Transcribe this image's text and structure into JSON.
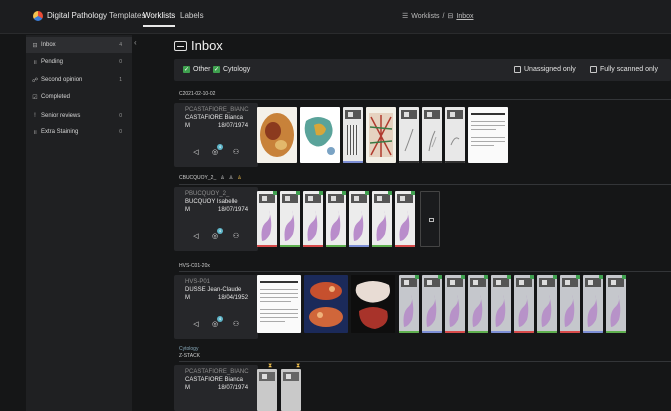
{
  "topbar": {
    "brand": "Digital Pathology",
    "nav": [
      "Templates",
      "Worklists",
      "Labels"
    ],
    "active_nav": "Worklists",
    "breadcrumb": {
      "root": "Worklists",
      "sep": "/",
      "current": "Inbox"
    }
  },
  "sidebar": {
    "items": [
      {
        "label": "Inbox",
        "count": "4",
        "icon": "tray-icon"
      },
      {
        "label": "Pending",
        "count": "0",
        "icon": "pause-icon"
      },
      {
        "label": "Second opinion",
        "count": "1",
        "icon": "people-icon"
      },
      {
        "label": "Completed",
        "count": "",
        "icon": "check-square-icon"
      },
      {
        "label": "Senior reviews",
        "count": "0",
        "icon": "exclamation-icon"
      },
      {
        "label": "Extra Staining",
        "count": "0",
        "icon": "pause-icon"
      }
    ]
  },
  "main": {
    "title": "Inbox",
    "filters": {
      "other": "Other",
      "cytology": "Cytology",
      "unassigned": "Unassigned only",
      "fully_scanned": "Fully scanned only"
    },
    "cases": [
      {
        "group_label": "C2021-02-10-02",
        "case_id": "PCASTAFIORE_BIANC",
        "patient": "CASTAFIORE Bianca",
        "sex": "M",
        "dob": "18/07/1974",
        "badge": "4"
      },
      {
        "group_label": "CBUCQUOY_2_",
        "case_id": "PBUCQUOY_2_",
        "patient": "BUCQUOY Isabelle",
        "sex": "M",
        "dob": "18/07/1974",
        "badge": "4"
      },
      {
        "group_label": "HVS-C01-20x",
        "case_id": "HVS-P01",
        "patient": "DUSSE Jean-Claude",
        "sex": "M",
        "dob": "18/04/1952",
        "badge": "4"
      },
      {
        "group_label": "Cytology",
        "group_sublabel": "Z-STACK",
        "case_id": "PCASTAFIORE_BIANC",
        "patient": "CASTAFIORE Bianca",
        "sex": "M",
        "dob": "18/07/1974"
      }
    ]
  },
  "colors": {
    "accent_green": "#3fa14f",
    "badge_blue": "#5fb6c9",
    "stain_pink": "#b07cc6",
    "pin_yellow": "#f2c14e"
  }
}
